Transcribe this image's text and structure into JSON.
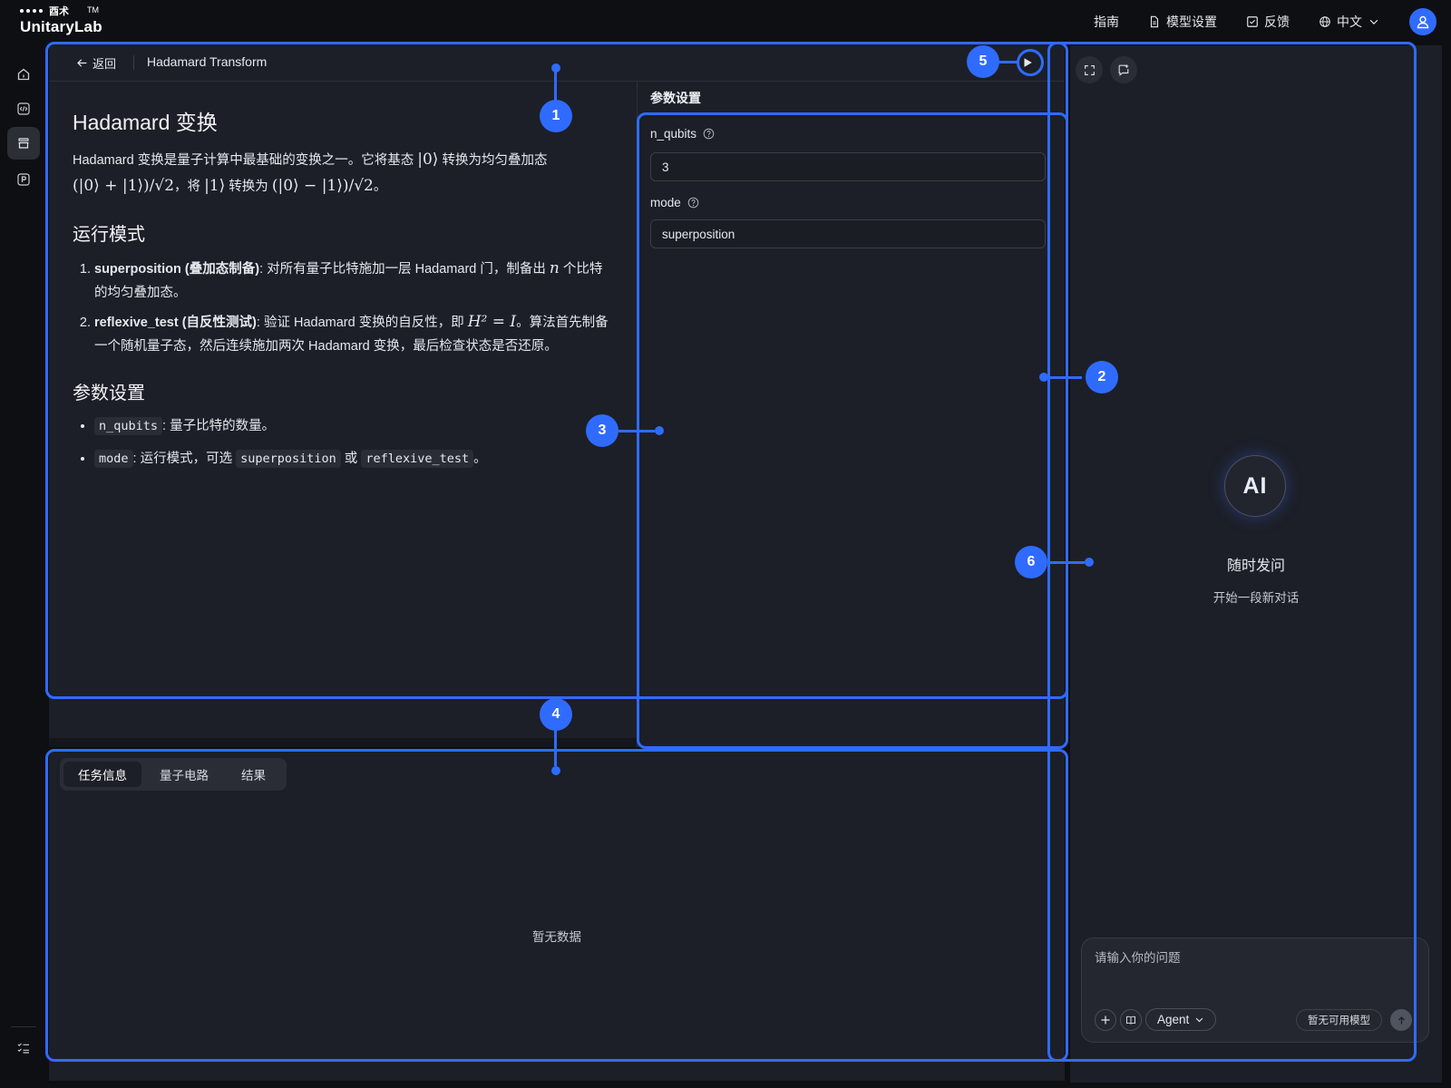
{
  "header": {
    "logo_cn": "酉术",
    "logo_tm": "TM",
    "logo_name": "UnitaryLab",
    "nav": {
      "guide": "指南",
      "model_settings": "模型设置",
      "feedback": "反馈",
      "language": "中文"
    }
  },
  "breadcrumb": {
    "back_label": "返回",
    "title": "Hadamard Transform"
  },
  "doc": {
    "title": "Hadamard 变换",
    "intro_1": "Hadamard 变换是量子计算中最基础的变换之一。它将基态 ",
    "intro_ket0": "|0⟩",
    "intro_2": " 转换为均匀叠加态",
    "intro_formula_1": "(|0⟩ + |1⟩)/√2",
    "intro_3": "，将 ",
    "intro_ket1": "|1⟩",
    "intro_4": " 转换为 ",
    "intro_formula_2": "(|0⟩ − |1⟩)/√2",
    "intro_5": "。",
    "modes_heading": "运行模式",
    "modes": [
      {
        "num": "1.",
        "name": "superposition (叠加态制备)",
        "text_a": ": 对所有量子比特施加一层 Hadamard 门，制备出 ",
        "math": "n",
        "text_b": " 个比特的均匀叠加态。"
      },
      {
        "num": "2.",
        "name": "reflexive_test (自反性测试)",
        "text_a": ": 验证 Hadamard 变换的自反性，即 ",
        "math": "H² = I",
        "text_b": "。算法首先制备一个随机量子态，然后连续施加两次 Hadamard 变换，最后检查状态是否还原。"
      }
    ],
    "params_heading": "参数设置",
    "params": [
      {
        "code": "n_qubits",
        "text": ": 量子比特的数量。"
      },
      {
        "code": "mode",
        "text": ": 运行模式，可选 ",
        "code2": "superposition",
        "text2": " 或 ",
        "code3": "reflexive_test",
        "text3": "。"
      }
    ]
  },
  "params_panel": {
    "title": "参数设置",
    "fields": [
      {
        "label": "n_qubits",
        "value": "3"
      },
      {
        "label": "mode",
        "value": "superposition"
      }
    ]
  },
  "tasks": {
    "tabs": [
      "任务信息",
      "量子电路",
      "结果"
    ],
    "active_tab": "任务信息",
    "empty_text": "暂无数据"
  },
  "chat": {
    "badge": "AI",
    "title": "随时发问",
    "subtitle": "开始一段新对话",
    "input_placeholder": "请输入你的问题",
    "agent_label": "Agent",
    "model_label": "暂无可用模型"
  },
  "callouts": [
    "1",
    "2",
    "3",
    "4",
    "5",
    "6"
  ],
  "colors": {
    "accent": "#2f6bff",
    "panel_bg": "#1c1f27",
    "page_bg": "#0e0f12"
  }
}
